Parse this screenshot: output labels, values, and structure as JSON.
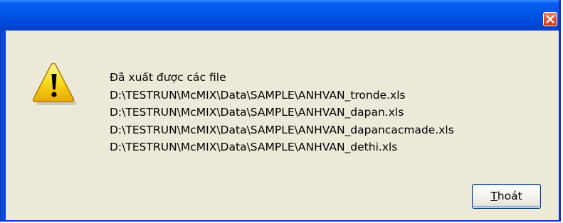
{
  "dialog": {
    "title": "",
    "icon": "warning-icon",
    "message_lines": [
      "Đã xuất được các file",
      "D:\\TESTRUN\\McMIX\\Data\\SAMPLE\\ANHVAN_tronde.xls",
      "D:\\TESTRUN\\McMIX\\Data\\SAMPLE\\ANHVAN_dapan.xls",
      "D:\\TESTRUN\\McMIX\\Data\\SAMPLE\\ANHVAN_dapancacmade.xls",
      "D:\\TESTRUN\\McMIX\\Data\\SAMPLE\\ANHVAN_dethi.xls"
    ],
    "ok_button": {
      "mnemonic": "T",
      "rest": "hoát"
    }
  },
  "colors": {
    "titlebar": "#0055e6",
    "dialog_bg": "#ece9d8",
    "close_button": "#e0522f",
    "warning_yellow": "#f8d81c"
  }
}
